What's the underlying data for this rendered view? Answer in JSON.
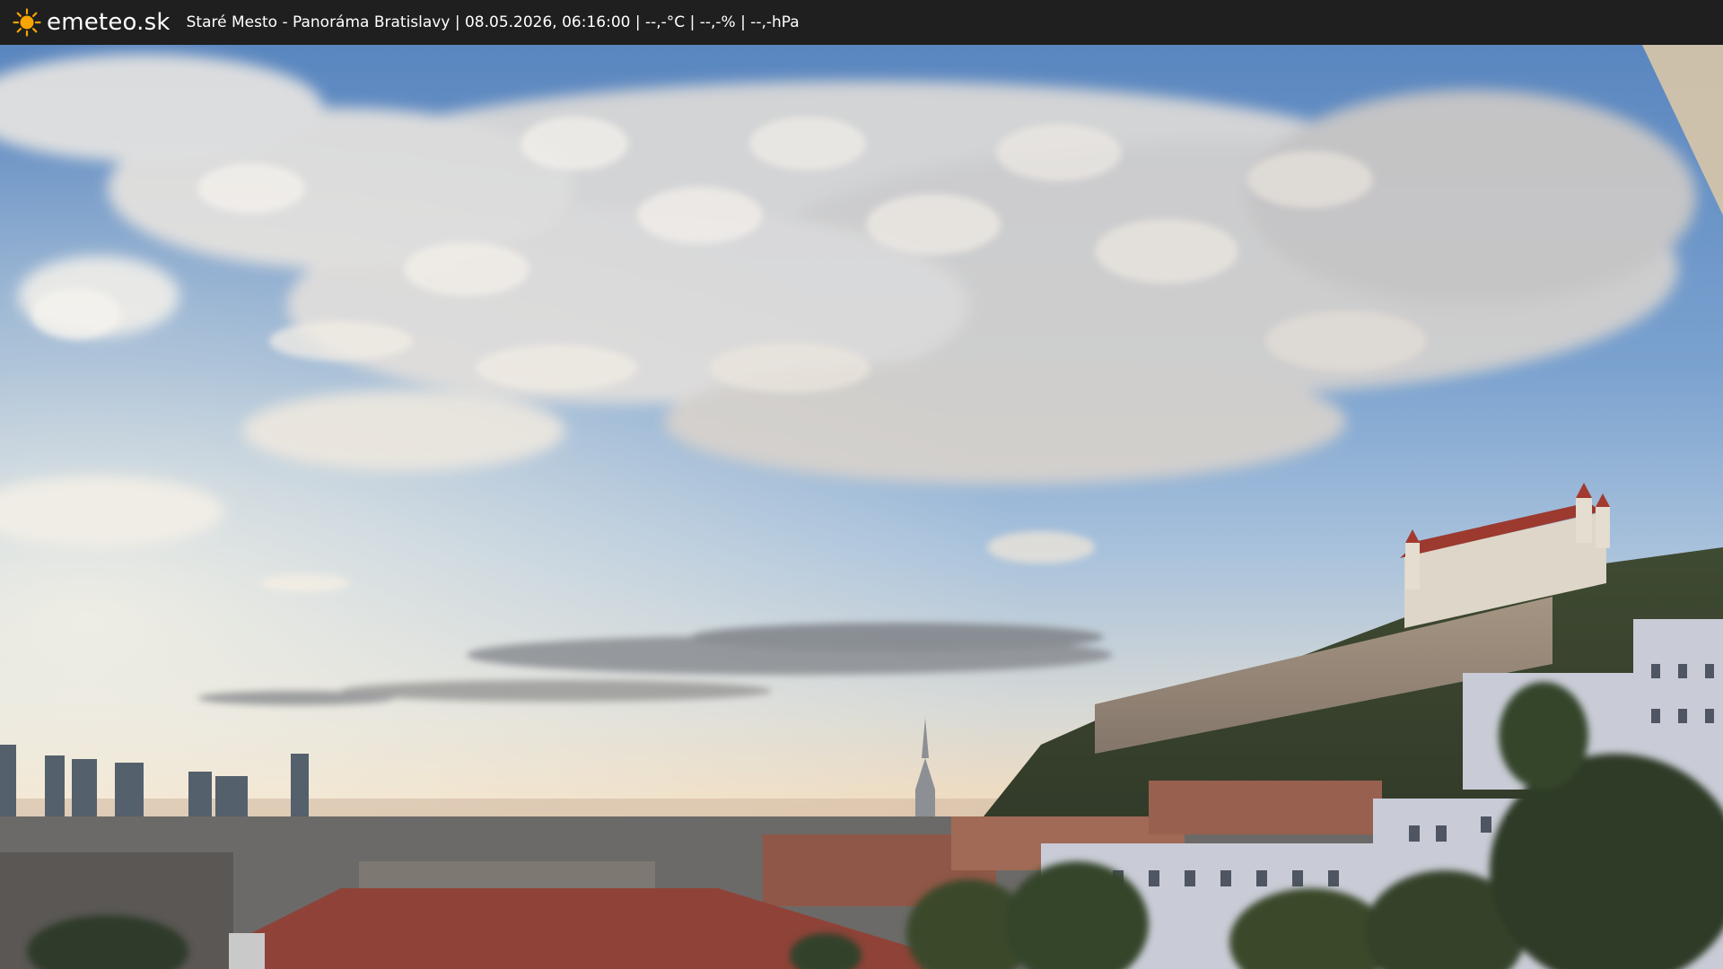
{
  "header": {
    "brand": "emeteo.sk",
    "logo_icon": "sun-icon",
    "caption": "Staré Mesto - Panoráma Bratislavy | 08.05.2026, 06:16:00 | --,-°C | --,-% | --,-hPa"
  },
  "colors": {
    "bar": "#1f1f1f",
    "sun": "#f5a400",
    "sky_top": "#4f7eb8",
    "sky_horizon": "#f1dcc0"
  }
}
